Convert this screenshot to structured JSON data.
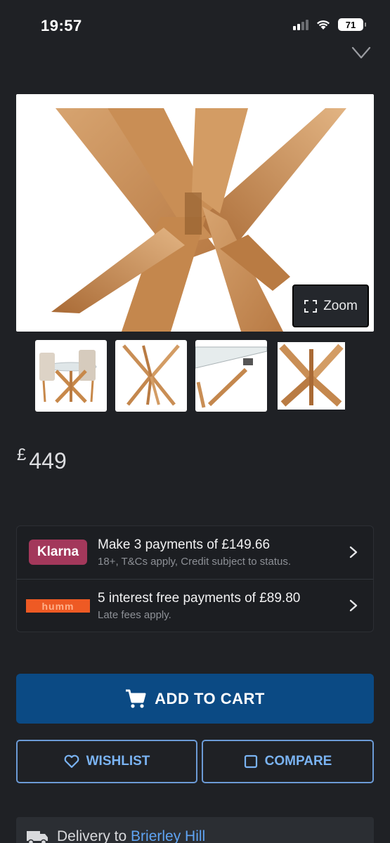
{
  "status_bar": {
    "time": "19:57",
    "battery": "71"
  },
  "product": {
    "favorite_icon": "heart-outline-icon",
    "zoom_label": "Zoom",
    "price_currency": "£",
    "price_amount": "449"
  },
  "finance": {
    "klarna": {
      "logo": "Klarna",
      "title": "Make 3 payments of £149.66",
      "subtitle": "18+, T&Cs apply, Credit subject to status."
    },
    "humm": {
      "logo": "humm",
      "title": "5 interest free payments of £89.80",
      "subtitle": "Late fees apply."
    }
  },
  "actions": {
    "add_to_cart": "ADD TO CART",
    "wishlist": "WISHLIST",
    "compare": "COMPARE"
  },
  "delivery": {
    "prefix": "Delivery to ",
    "location": "Brierley Hill"
  },
  "colors": {
    "background": "#1f2125",
    "primary_button": "#0b4a84",
    "outline_accent": "#7ab3f2",
    "klarna_pink": "#a3385b",
    "humm_orange": "#ee5a24"
  }
}
